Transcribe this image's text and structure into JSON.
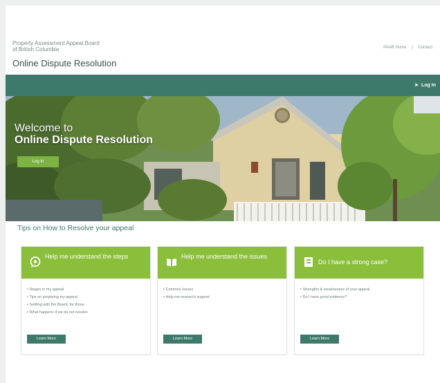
{
  "header": {
    "org_line1": "Property Assessment Appeal Board",
    "org_line2": "of British Columbia",
    "site_title": "Online Dispute Resolution",
    "links": [
      "PAAB Home",
      "Contact"
    ],
    "link_separator": "|"
  },
  "navbar": {
    "login_label": "Log In",
    "login_icon": "sign-in-icon"
  },
  "hero": {
    "line1": "Welcome to",
    "line2": "Online Dispute Resolution",
    "button_label": "Log In"
  },
  "tips_heading": "Tips on How to Resolve your appeal",
  "cards": [
    {
      "icon": "chat-bubble-icon",
      "title": "Help me understand the steps",
      "items": [
        "Stages in my appeal",
        "Tips on preparing my appeal",
        "Settling with the Board, for those",
        "What happens if we do not resolve"
      ],
      "button": "Learn More"
    },
    {
      "icon": "open-book-icon",
      "title": "Help me understand the issues",
      "items": [
        "Common Issues",
        "Help me research support"
      ],
      "button": "Learn More"
    },
    {
      "icon": "document-icon",
      "title": "Do I have a strong case?",
      "items": [
        "Strengths & weaknesses of your appeal",
        "Do I have good evidence?"
      ],
      "button": "Learn More"
    }
  ],
  "colors": {
    "primary": "#3d7a6b",
    "accent": "#8bbf3b",
    "hero_button": "#7cb342"
  }
}
